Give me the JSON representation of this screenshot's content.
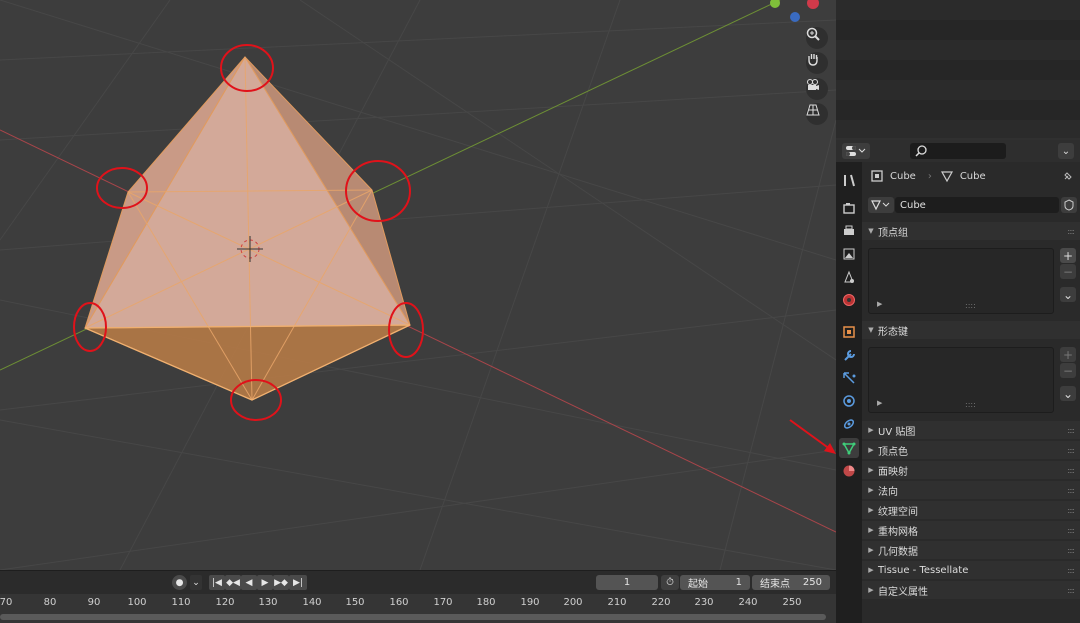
{
  "viewport": {
    "nav_icons": [
      "zoom-icon",
      "hand-pan-icon",
      "camera-icon",
      "grid-perspective-icon"
    ],
    "axis_colors": {
      "x": "#c24a4a",
      "y": "#7fa73a"
    },
    "mesh_color": "#e09a5e",
    "annotation_color": "#e0121a"
  },
  "timeline": {
    "current_frame": "1",
    "start_label": "起始",
    "start_value": "1",
    "end_label": "结束点",
    "end_value": "250",
    "ticks": [
      "70",
      "80",
      "90",
      "100",
      "110",
      "120",
      "130",
      "140",
      "150",
      "160",
      "170",
      "180",
      "190",
      "200",
      "210",
      "220",
      "230",
      "240",
      "250"
    ]
  },
  "properties": {
    "object_name": "Cube",
    "mesh_name": "Cube",
    "datablock_name": "Cube",
    "vertex_groups_title": "顶点组",
    "shape_keys_title": "形态键",
    "add_label": "+",
    "remove_label": "−",
    "sections": [
      "UV 贴图",
      "顶点色",
      "面映射",
      "法向",
      "纹理空间",
      "重构网格",
      "几何数据",
      "Tissue - Tessellate",
      "自定义属性"
    ]
  }
}
